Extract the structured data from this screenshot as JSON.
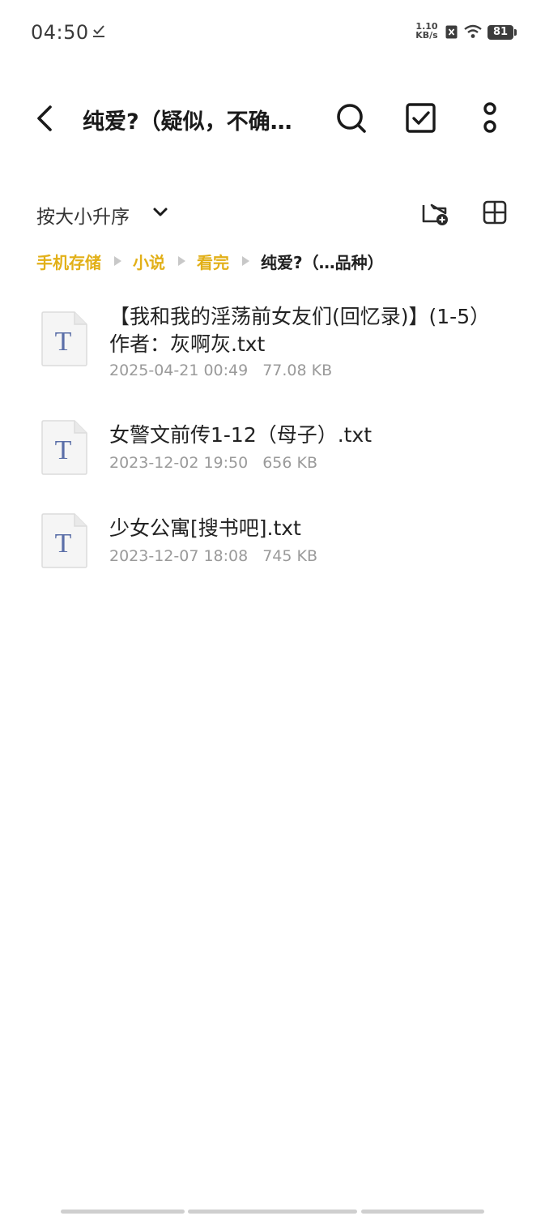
{
  "status_bar": {
    "time": "04:50",
    "net_speed_value": "1.10",
    "net_speed_unit": "KB/s",
    "battery": "81"
  },
  "toolbar": {
    "title": "纯爱?（疑似，不确…"
  },
  "sort": {
    "label": "按大小升序"
  },
  "breadcrumb": [
    {
      "label": "手机存储"
    },
    {
      "label": "小说"
    },
    {
      "label": "看完"
    },
    {
      "label": "纯爱?（…品种）"
    }
  ],
  "files": [
    {
      "name": "【我和我的淫荡前女友们(回忆录)】(1-5） 作者：灰啊灰.txt",
      "date": "2025-04-21 00:49",
      "size": "77.08 KB",
      "icon": "txt-file-icon"
    },
    {
      "name": "女警文前传1-12（母子）.txt",
      "date": "2023-12-02 19:50",
      "size": "656 KB",
      "icon": "txt-file-icon"
    },
    {
      "name": "少女公寓[搜书吧].txt",
      "date": "2023-12-07 18:08",
      "size": "745 KB",
      "icon": "txt-file-icon"
    }
  ],
  "colors": {
    "accent": "#e2b018",
    "text_primary": "#222222",
    "text_secondary": "#9a9a9a",
    "file_icon_letter": "#5b6fa8"
  }
}
